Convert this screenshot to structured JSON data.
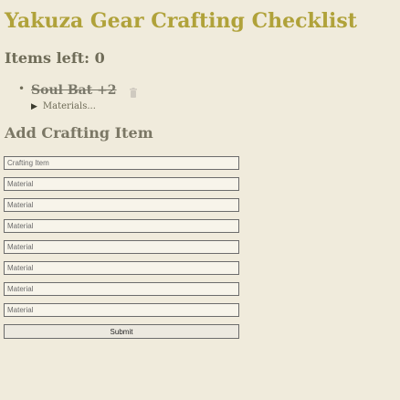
{
  "header": {
    "title": "Yakuza Gear Crafting Checklist",
    "items_left": "Items left: 0"
  },
  "items": [
    {
      "name": "Soul Bat +2",
      "done": true,
      "materials_label": "Materials..."
    }
  ],
  "form": {
    "section_title": "Add Crafting Item",
    "item_placeholder": "Crafting Item",
    "material_placeholder": "Material",
    "submit_label": "Submit"
  },
  "icons": {
    "delete": "trash-icon",
    "expand": "caret-right-icon"
  },
  "colors": {
    "background": "#f0ebdc",
    "title": "#b0a23a",
    "text": "#6f6c58"
  }
}
